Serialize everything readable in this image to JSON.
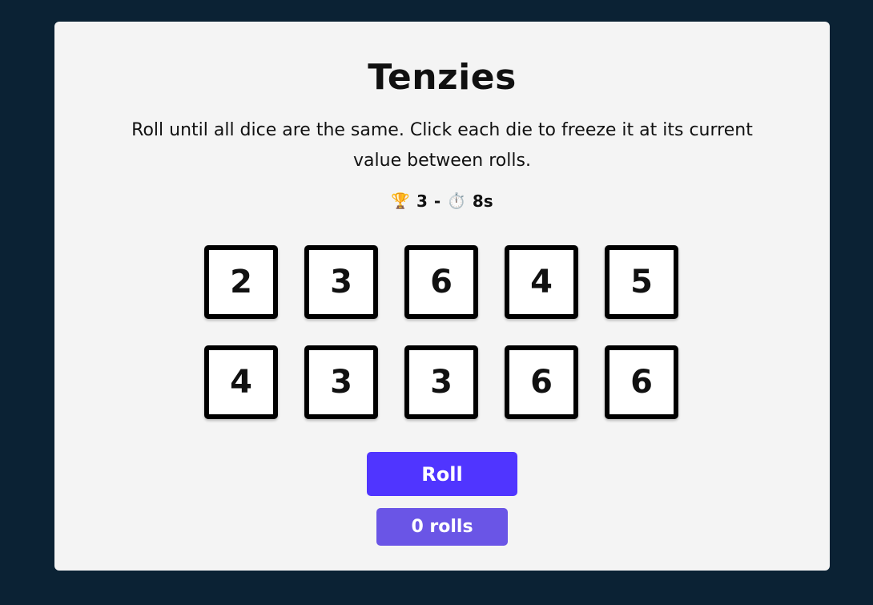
{
  "game": {
    "title": "Tenzies",
    "instructions": "Roll until all dice are the same. Click each die to freeze it at its current value between rolls.",
    "stats": {
      "trophy_icon": "🏆",
      "best_score": "3",
      "separator": "-",
      "timer_icon": "⏱️",
      "time": "8s"
    },
    "dice": [
      {
        "value": "2",
        "held": false
      },
      {
        "value": "3",
        "held": false
      },
      {
        "value": "6",
        "held": false
      },
      {
        "value": "4",
        "held": false
      },
      {
        "value": "5",
        "held": false
      },
      {
        "value": "4",
        "held": false
      },
      {
        "value": "3",
        "held": false
      },
      {
        "value": "3",
        "held": false
      },
      {
        "value": "6",
        "held": false
      },
      {
        "value": "6",
        "held": false
      }
    ],
    "roll_button_label": "Roll",
    "roll_count_label": "0 rolls"
  },
  "colors": {
    "page_background": "#0b2234",
    "card_background": "#f4f4f4",
    "die_background": "#ffffff",
    "die_border": "#000000",
    "roll_button": "#5035ff",
    "roll_count_badge": "#6a55e6"
  }
}
